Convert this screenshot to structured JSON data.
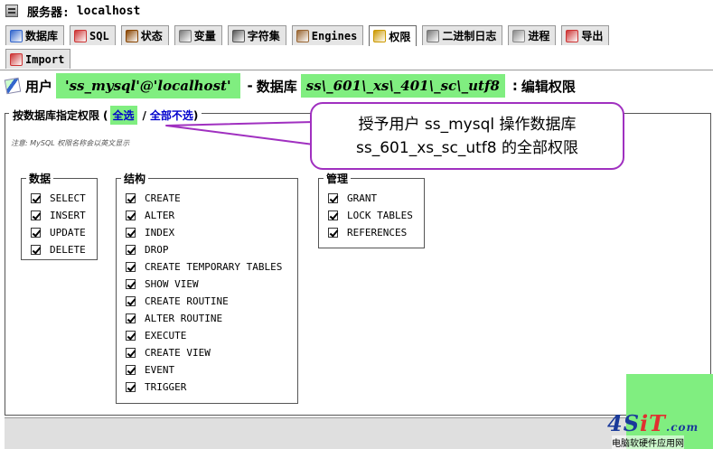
{
  "server": {
    "label": "服务器:",
    "name": "localhost",
    "icon": "server-icon"
  },
  "tabs_row1": [
    {
      "label": "数据库",
      "icon": "database-icon",
      "color": "#3366cc"
    },
    {
      "label": "SQL",
      "icon": "sql-icon",
      "color": "#cc3333"
    },
    {
      "label": "状态",
      "icon": "status-icon",
      "color": "#884400"
    },
    {
      "label": "变量",
      "icon": "variables-icon",
      "color": "#777777"
    },
    {
      "label": "字符集",
      "icon": "charset-icon",
      "color": "#555555"
    },
    {
      "label": "Engines",
      "icon": "engines-icon",
      "color": "#996633"
    },
    {
      "label": "权限",
      "icon": "privileges-icon",
      "color": "#cc9900",
      "active": true
    },
    {
      "label": "二进制日志",
      "icon": "binlog-icon",
      "color": "#777777"
    },
    {
      "label": "进程",
      "icon": "processes-icon",
      "color": "#888888"
    },
    {
      "label": "导出",
      "icon": "export-icon",
      "color": "#cc3333"
    }
  ],
  "tabs_row2": [
    {
      "label": "Import",
      "icon": "import-icon",
      "color": "#cc3333"
    }
  ],
  "heading": {
    "user_label": "用户",
    "user": "'ss_mysql'@'localhost'",
    "dash": "-",
    "db_label": "数据库",
    "database": "ss\\_601\\_xs\\_401\\_sc\\_utf8",
    "colon": ":",
    "action": "编辑权限"
  },
  "section": {
    "title": "按数据库指定权限",
    "open_paren": "(",
    "check_all": "全选",
    "slash": "/",
    "uncheck_all": "全部不选",
    "close_paren": ")",
    "note": "注意: MySQL 权限名称会以英文显示"
  },
  "groups": {
    "data": {
      "title": "数据",
      "items": [
        "SELECT",
        "INSERT",
        "UPDATE",
        "DELETE"
      ]
    },
    "structure": {
      "title": "结构",
      "items": [
        "CREATE",
        "ALTER",
        "INDEX",
        "DROP",
        "CREATE TEMPORARY TABLES",
        "SHOW VIEW",
        "CREATE ROUTINE",
        "ALTER ROUTINE",
        "EXECUTE",
        "CREATE VIEW",
        "EVENT",
        "TRIGGER"
      ]
    },
    "admin": {
      "title": "管理",
      "items": [
        "GRANT",
        "LOCK TABLES",
        "REFERENCES"
      ]
    }
  },
  "callout": {
    "line1": "授予用户  ss_mysql 操作数据库",
    "line2": "ss_601_xs_sc_utf8 的全部权限"
  },
  "watermark": {
    "logo_main": "4S",
    "logo_it": "iT",
    "logo_com": ".com",
    "sub": "电脑软硬件应用网"
  },
  "colors": {
    "highlight": "#80ee80",
    "callout_border": "#a030c0",
    "link": "#0000cc"
  }
}
